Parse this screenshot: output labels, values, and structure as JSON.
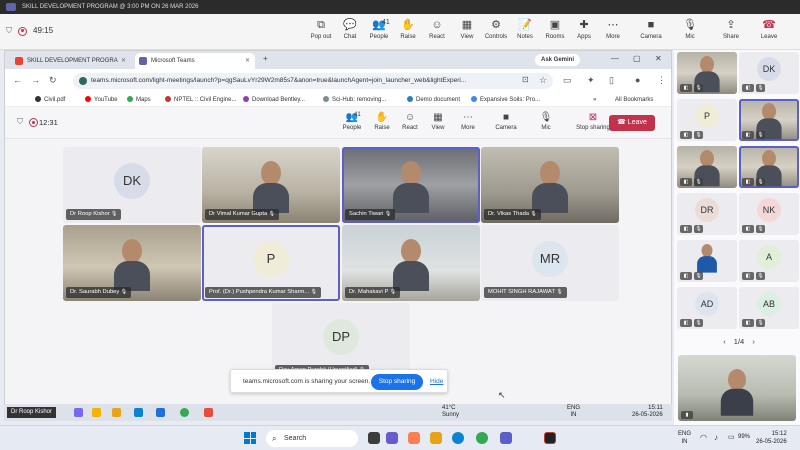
{
  "window": {
    "title": "SKILL DEVELOPMENT PROGRAM @ 3:00 PM ON 26 MAR 2026"
  },
  "meeting": {
    "timer": "49:15",
    "controls": [
      {
        "label": "Pop out",
        "icon": "pop-out-icon",
        "glyph": "⧉"
      },
      {
        "label": "Chat",
        "icon": "chat-icon",
        "glyph": "💬"
      },
      {
        "label": "People",
        "icon": "people-icon",
        "glyph": "👥",
        "count": "41"
      },
      {
        "label": "Raise",
        "icon": "hand-icon",
        "glyph": "✋"
      },
      {
        "label": "React",
        "icon": "react-icon",
        "glyph": "☺"
      },
      {
        "label": "View",
        "icon": "view-icon",
        "glyph": "▦"
      },
      {
        "label": "Controls",
        "icon": "controls-icon",
        "glyph": "⚙"
      },
      {
        "label": "Notes",
        "icon": "notes-icon",
        "glyph": "📝"
      },
      {
        "label": "Rooms",
        "icon": "rooms-icon",
        "glyph": "▣"
      },
      {
        "label": "Apps",
        "icon": "apps-icon",
        "glyph": "✚"
      },
      {
        "label": "More",
        "icon": "more-icon",
        "glyph": "⋯"
      },
      {
        "label": "Camera",
        "icon": "camera-icon",
        "glyph": "■"
      },
      {
        "label": "Mic",
        "icon": "mic-off-icon",
        "glyph": "🎙"
      },
      {
        "label": "Share",
        "icon": "share-icon",
        "glyph": "⇪"
      },
      {
        "label": "Leave",
        "icon": "leave-icon",
        "glyph": "☎"
      }
    ]
  },
  "browser": {
    "tabs": [
      {
        "label": "SKILL DEVELOPMENT PROGRA",
        "icon": "gmail-icon"
      },
      {
        "label": "Microsoft Teams",
        "icon": "teams-icon"
      }
    ],
    "ask_gemini": "Ask Gemini",
    "url": "teams.microsoft.com/light-meetings/launch?p=qgSauLvYr29W2m85s7&anon=true&launchAgent=join_launcher_web&lightExperi...",
    "bookmarks": [
      {
        "label": "Civil.pdf",
        "color": "#333333"
      },
      {
        "label": "YouTube",
        "color": "#ff0000"
      },
      {
        "label": "Maps",
        "color": "#34a853"
      },
      {
        "label": "NPTEL :: Civil Engine...",
        "color": "#c0392b"
      },
      {
        "label": "Download Bentley...",
        "color": "#8e44ad"
      },
      {
        "label": "Sci-Hub: removing...",
        "color": "#7f8c8d"
      },
      {
        "label": "Demo document",
        "color": "#2980b9"
      },
      {
        "label": "Expansive Soils: Pro...",
        "color": "#4285f4"
      }
    ],
    "all_bookmarks": "All Bookmarks"
  },
  "inner_meeting": {
    "time": "12:31",
    "people_count": "41",
    "buttons": [
      {
        "label": "People",
        "glyph": "👥",
        "icon": "people-icon"
      },
      {
        "label": "Raise",
        "glyph": "✋",
        "icon": "hand-icon"
      },
      {
        "label": "React",
        "glyph": "☺",
        "icon": "react-icon"
      },
      {
        "label": "View",
        "glyph": "▦",
        "icon": "view-icon"
      },
      {
        "label": "More",
        "glyph": "⋯",
        "icon": "more-icon"
      },
      {
        "label": "Camera",
        "glyph": "■",
        "icon": "camera-off-icon"
      },
      {
        "label": "Mic",
        "glyph": "🎙",
        "icon": "mic-off-icon"
      },
      {
        "label": "Stop sharing",
        "glyph": "⊠",
        "icon": "stop-sharing-icon"
      }
    ],
    "leave": "Leave"
  },
  "tiles": [
    {
      "name": "Dr Roop Kishor",
      "type": "avatar",
      "initials": "DK",
      "color": "#d8dce8"
    },
    {
      "name": "Dr Vimal Kumar Gupta",
      "type": "video",
      "variant": "c"
    },
    {
      "name": "Sachin Tiwari",
      "type": "video",
      "variant": "b",
      "active": true
    },
    {
      "name": "Dr. Vikas Thada",
      "type": "video",
      "variant": "d"
    },
    {
      "name": "Dr. Saurabh Dubey",
      "type": "video",
      "variant": "a"
    },
    {
      "name": "Prof. (Dr.) Pushpendra Kumar Sharm...",
      "type": "avatar",
      "initials": "P",
      "color": "#f1ecd8",
      "active": true
    },
    {
      "name": "Dr. Mahakavi P",
      "type": "video",
      "variant": "e"
    },
    {
      "name": "MOHIT SINGH RAJAWAT",
      "type": "avatar",
      "initials": "MR",
      "color": "#dde6ee"
    },
    {
      "name": "Dev Arpan Purohit (Unverified)",
      "type": "avatar",
      "initials": "DP",
      "color": "#dfe8dc"
    }
  ],
  "share_bar": {
    "text": "teams.microsoft.com is sharing your screen.",
    "stop": "Stop sharing",
    "hide": "Hide"
  },
  "inner_taskbar": {
    "presenter": "Dr Roop Kishor",
    "temp": "41°C",
    "weather": "Sunny",
    "lang1": "ENG",
    "lang2": "IN",
    "time": "15:11",
    "date": "26-05-2026"
  },
  "outer_taskbar": {
    "search": "Search",
    "lang1": "ENG",
    "lang2": "IN",
    "battery": "99%",
    "time": "15:12",
    "date": "26-05-2026"
  },
  "panel": {
    "tiles": [
      {
        "type": "video"
      },
      {
        "type": "avatar",
        "initials": "DK",
        "color": "#d8dce8"
      },
      {
        "type": "avatar",
        "initials": "P",
        "color": "#f1ecd8"
      },
      {
        "type": "video",
        "active": true
      },
      {
        "type": "video"
      },
      {
        "type": "video",
        "active": true
      },
      {
        "type": "avatar",
        "initials": "DR",
        "color": "#ecdcd6"
      },
      {
        "type": "avatar",
        "initials": "NK",
        "color": "#f4d8d8"
      },
      {
        "type": "photo"
      },
      {
        "type": "avatar",
        "initials": "A",
        "color": "#e2efd8"
      },
      {
        "type": "avatar",
        "initials": "AD",
        "color": "#dde4ee"
      },
      {
        "type": "avatar",
        "initials": "AB",
        "color": "#dcefe3"
      }
    ],
    "pager": "1/4"
  }
}
